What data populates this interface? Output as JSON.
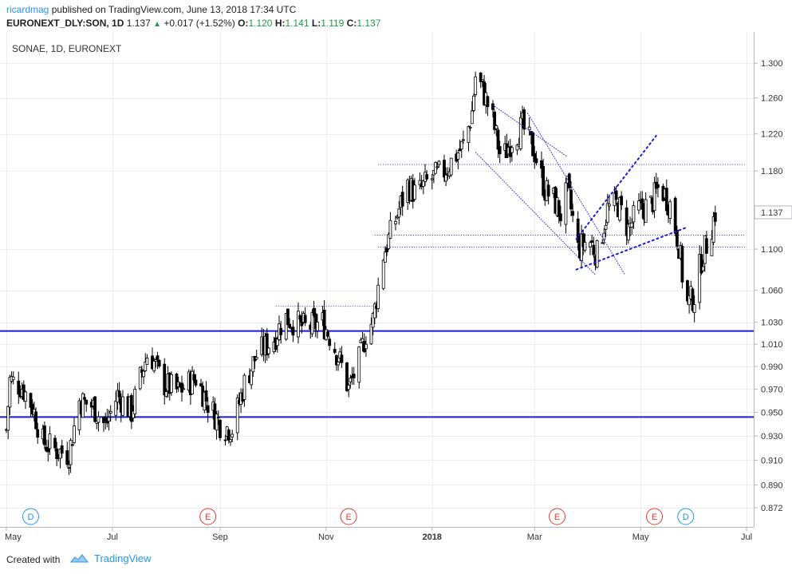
{
  "header": {
    "author": "ricardmag",
    "published_text": "published on TradingView.com, June 13, 2018 17:34 UTC",
    "symbol": "EURONEXT_DLY:SON, 1D",
    "last": "1.137",
    "change": "+0.017 (+1.52%)",
    "open_label": "O:",
    "open_value": "1.120",
    "high_label": "H:",
    "high_value": "1.141",
    "low_label": "L:",
    "low_value": "1.119",
    "close_label": "C:",
    "close_value": "1.137"
  },
  "footer": {
    "created_with": "Created with",
    "brand": "TradingView"
  },
  "colors": {
    "accent": "#2196f3",
    "up": "#1a9e46",
    "candle_bull": "#ffffff",
    "candle_bear": "#000000",
    "support_line": "#1a1adb",
    "event_earnings": "#e53935",
    "event_dividend": "#2196f3"
  },
  "chart_data": {
    "type": "candlestick",
    "title": "SONAE, 1D, EURONEXT",
    "y_ticks": [
      "1.300",
      "1.260",
      "1.220",
      "1.180",
      "1.137",
      "1.100",
      "1.060",
      "1.030",
      "1.010",
      "0.990",
      "0.970",
      "0.950",
      "0.930",
      "0.910",
      "0.890",
      "0.872"
    ],
    "y_scale": "log",
    "ylim": [
      0.862,
      1.318
    ],
    "x_ticks": [
      "May",
      "Jul",
      "Sep",
      "Nov",
      "2018",
      "Mar",
      "May",
      "Jul"
    ],
    "x_tick_dates": [
      "2017-05-01",
      "2017-07-01",
      "2017-09-01",
      "2017-11-01",
      "2018-01-01",
      "2018-03-01",
      "2018-05-01",
      "2018-07-01"
    ],
    "x_range": [
      "2017-05-01",
      "2018-07-01"
    ],
    "last_price_label": "1.137",
    "horizontal_levels": [
      {
        "price": 1.022,
        "style": "solid"
      },
      {
        "price": 0.946,
        "style": "solid"
      },
      {
        "price": 1.187,
        "style": "dotted",
        "from": "2017-12-01",
        "to": "2018-06-30"
      },
      {
        "price": 1.114,
        "style": "dotted",
        "from": "2017-11-29",
        "to": "2018-06-30"
      },
      {
        "price": 1.102,
        "style": "dotted",
        "from": "2017-12-01",
        "to": "2018-06-30"
      },
      {
        "price": 1.045,
        "style": "dotted",
        "from": "2017-10-03",
        "to": "2017-11-28"
      }
    ],
    "trend_lines": [
      {
        "from": [
          "2018-02-05",
          1.252
        ],
        "to": [
          "2018-03-20",
          1.195
        ],
        "style": "dotted"
      },
      {
        "from": [
          "2018-01-26",
          1.2
        ],
        "to": [
          "2018-04-05",
          1.075
        ],
        "style": "dotted"
      },
      {
        "from": [
          "2018-02-25",
          1.243
        ],
        "to": [
          "2018-04-22",
          1.075
        ],
        "style": "dotted"
      },
      {
        "from": [
          "2018-03-25",
          1.08
        ],
        "to": [
          "2018-05-28",
          1.122
        ],
        "style": "dotted-bold"
      },
      {
        "from": [
          "2018-03-25",
          1.11
        ],
        "to": [
          "2018-05-10",
          1.218
        ],
        "style": "dotted-bold"
      }
    ],
    "events": [
      {
        "label": "D",
        "kind": "dividend",
        "date": "2017-05-15"
      },
      {
        "label": "E",
        "kind": "earnings",
        "date": "2017-08-25"
      },
      {
        "label": "E",
        "kind": "earnings",
        "date": "2017-11-14"
      },
      {
        "label": "E",
        "kind": "earnings",
        "date": "2018-03-14"
      },
      {
        "label": "E",
        "kind": "earnings",
        "date": "2018-05-09"
      },
      {
        "label": "D",
        "kind": "dividend",
        "date": "2018-05-27"
      }
    ],
    "candles_anchors": [
      [
        "2017-05-01",
        0.935
      ],
      [
        "2017-05-03",
        0.978
      ],
      [
        "2017-05-10",
        0.972
      ],
      [
        "2017-05-16",
        0.955
      ],
      [
        "2017-05-22",
        0.925
      ],
      [
        "2017-05-30",
        0.918
      ],
      [
        "2017-06-06",
        0.915
      ],
      [
        "2017-06-12",
        0.96
      ],
      [
        "2017-06-20",
        0.955
      ],
      [
        "2017-06-27",
        0.938
      ],
      [
        "2017-07-04",
        0.965
      ],
      [
        "2017-07-12",
        0.95
      ],
      [
        "2017-07-18",
        0.985
      ],
      [
        "2017-07-22",
        1.005
      ],
      [
        "2017-07-30",
        0.975
      ],
      [
        "2017-08-08",
        0.968
      ],
      [
        "2017-08-18",
        0.98
      ],
      [
        "2017-08-26",
        0.955
      ],
      [
        "2017-09-02",
        0.938
      ],
      [
        "2017-09-08",
        0.936
      ],
      [
        "2017-09-15",
        0.975
      ],
      [
        "2017-09-22",
        1.0
      ],
      [
        "2017-10-02",
        1.015
      ],
      [
        "2017-10-08",
        1.035
      ],
      [
        "2017-10-20",
        1.025
      ],
      [
        "2017-10-30",
        1.03
      ],
      [
        "2017-11-04",
        1.015
      ],
      [
        "2017-11-10",
        0.99
      ],
      [
        "2017-11-14",
        0.97
      ],
      [
        "2017-11-20",
        0.995
      ],
      [
        "2017-11-24",
        1.02
      ],
      [
        "2017-11-28",
        1.032
      ],
      [
        "2017-12-04",
        1.095
      ],
      [
        "2017-12-11",
        1.13
      ],
      [
        "2017-12-18",
        1.165
      ],
      [
        "2017-12-23",
        1.155
      ],
      [
        "2017-12-30",
        1.17
      ],
      [
        "2018-01-08",
        1.18
      ],
      [
        "2018-01-14",
        1.195
      ],
      [
        "2018-01-20",
        1.21
      ],
      [
        "2018-01-24",
        1.245
      ],
      [
        "2018-01-26",
        1.285
      ],
      [
        "2018-01-30",
        1.27
      ],
      [
        "2018-02-05",
        1.235
      ],
      [
        "2018-02-10",
        1.19
      ],
      [
        "2018-02-16",
        1.215
      ],
      [
        "2018-02-22",
        1.228
      ],
      [
        "2018-03-01",
        1.2
      ],
      [
        "2018-03-07",
        1.16
      ],
      [
        "2018-03-12",
        1.15
      ],
      [
        "2018-03-16",
        1.135
      ],
      [
        "2018-03-20",
        1.16
      ],
      [
        "2018-03-26",
        1.1
      ],
      [
        "2018-04-01",
        1.11
      ],
      [
        "2018-04-06",
        1.095
      ],
      [
        "2018-04-12",
        1.14
      ],
      [
        "2018-04-18",
        1.145
      ],
      [
        "2018-04-24",
        1.12
      ],
      [
        "2018-04-30",
        1.14
      ],
      [
        "2018-05-07",
        1.145
      ],
      [
        "2018-05-12",
        1.165
      ],
      [
        "2018-05-18",
        1.145
      ],
      [
        "2018-05-23",
        1.105
      ],
      [
        "2018-05-27",
        1.045
      ],
      [
        "2018-06-01",
        1.055
      ],
      [
        "2018-06-05",
        1.09
      ],
      [
        "2018-06-09",
        1.11
      ],
      [
        "2018-06-13",
        1.137
      ]
    ]
  }
}
